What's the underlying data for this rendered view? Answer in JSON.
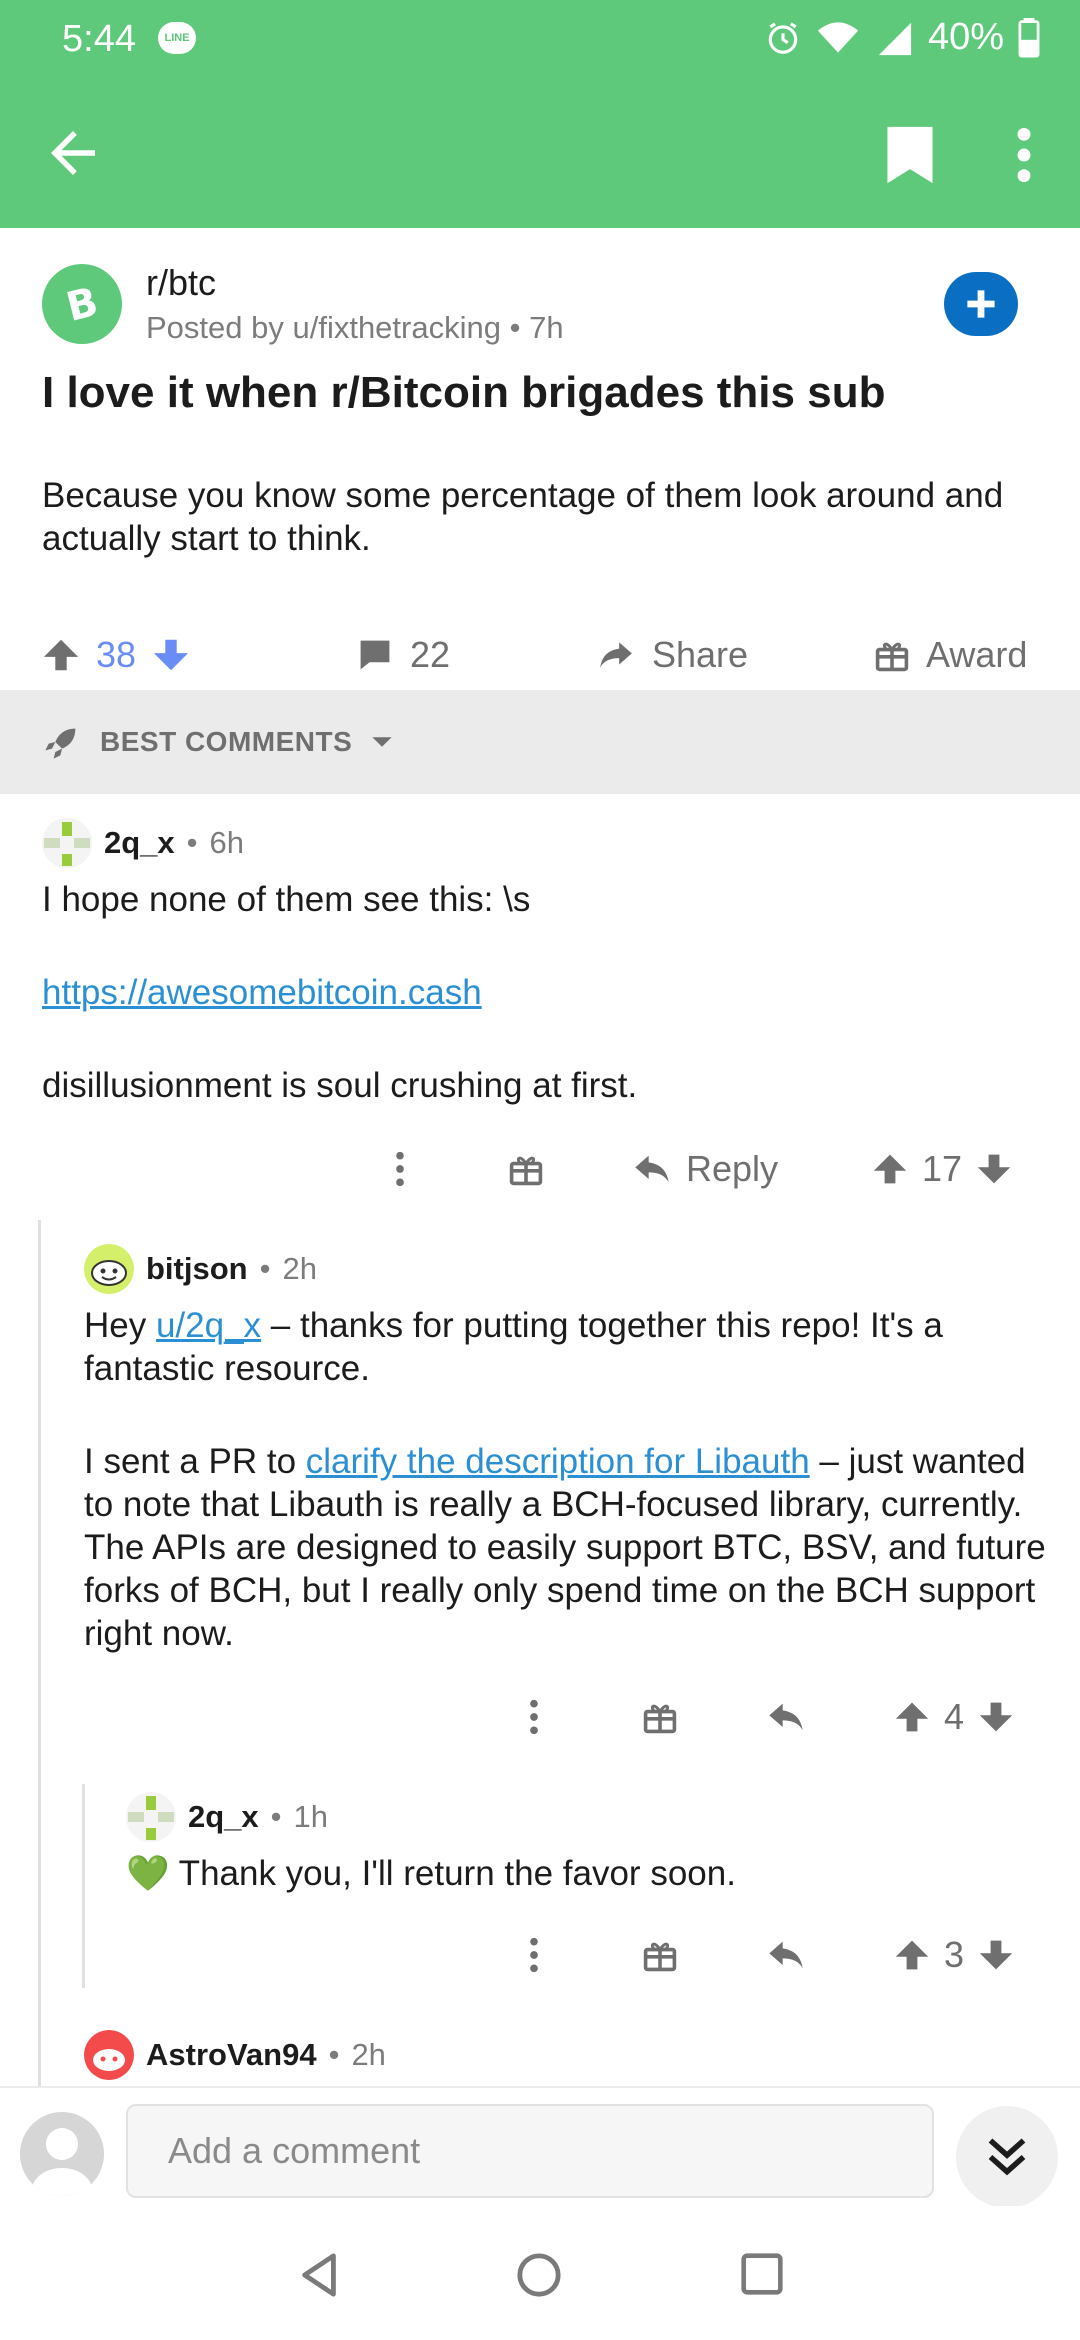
{
  "status": {
    "time": "5:44",
    "line_label": "LINE",
    "battery": "40%"
  },
  "appbar": {
    "back_icon": "arrow-left-icon",
    "bookmark_icon": "bookmark-icon",
    "more_icon": "more-vert-icon"
  },
  "post": {
    "subreddit": "r/btc",
    "posted_by": "Posted by u/fixthetracking",
    "age": "7h",
    "title": "I love it when r/Bitcoin brigades this sub",
    "body": "Because you know some percentage of them look around and actually start to think.",
    "votes": "38",
    "comments": "22",
    "share_label": "Share",
    "award_label": "Award"
  },
  "sort": {
    "label": "BEST COMMENTS"
  },
  "comments": [
    {
      "author": "2q_x",
      "age": "6h",
      "line1": "I hope none of them see this: \\s",
      "link": "https://awesomebitcoin.cash",
      "line2": "disillusionment is soul crushing at first.",
      "reply_label": "Reply",
      "votes": "17"
    },
    {
      "author": "bitjson",
      "age": "2h",
      "p1_a": "Hey ",
      "p1_link": "u/2q_x",
      "p1_b": " – thanks for putting together this repo! It's a fantastic resource.",
      "p2_a": "I sent a PR to ",
      "p2_link": "clarify the description for Libauth",
      "p2_b": " – just wanted to note that Libauth is really a BCH-focused library, currently. The APIs are designed to easily support BTC, BSV, and future forks of BCH, but I really only spend time on the BCH support right now.",
      "votes": "4"
    },
    {
      "author": "2q_x",
      "age": "1h",
      "emoji": "💚",
      "text": " Thank you, I'll return the favor soon.",
      "votes": "3"
    },
    {
      "author": "AstroVan94",
      "age": "2h"
    }
  ],
  "composer": {
    "placeholder": "Add a comment"
  },
  "colors": {
    "header": "#5ec97a",
    "upvote_active": "#6a8df5",
    "link": "#2b8fd4",
    "join": "#0a6fc2"
  }
}
